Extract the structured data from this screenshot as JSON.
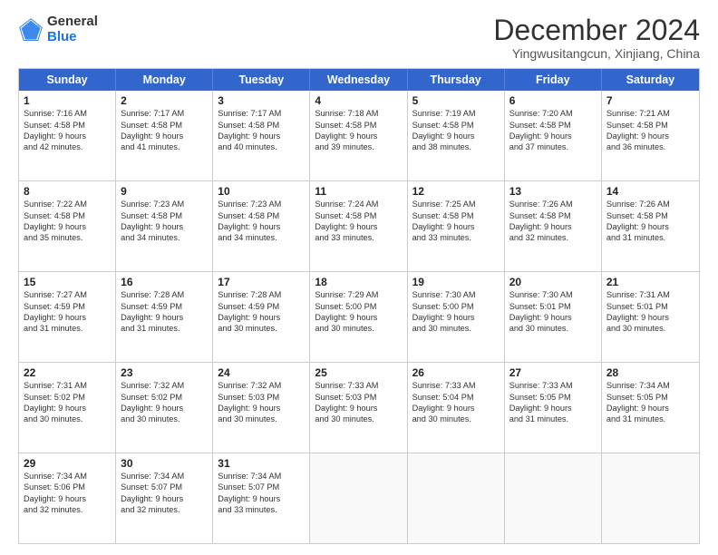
{
  "logo": {
    "general": "General",
    "blue": "Blue"
  },
  "title": "December 2024",
  "subtitle": "Yingwusitangcun, Xinjiang, China",
  "weekdays": [
    "Sunday",
    "Monday",
    "Tuesday",
    "Wednesday",
    "Thursday",
    "Friday",
    "Saturday"
  ],
  "rows": [
    [
      {
        "day": "1",
        "lines": [
          "Sunrise: 7:16 AM",
          "Sunset: 4:58 PM",
          "Daylight: 9 hours",
          "and 42 minutes."
        ]
      },
      {
        "day": "2",
        "lines": [
          "Sunrise: 7:17 AM",
          "Sunset: 4:58 PM",
          "Daylight: 9 hours",
          "and 41 minutes."
        ]
      },
      {
        "day": "3",
        "lines": [
          "Sunrise: 7:17 AM",
          "Sunset: 4:58 PM",
          "Daylight: 9 hours",
          "and 40 minutes."
        ]
      },
      {
        "day": "4",
        "lines": [
          "Sunrise: 7:18 AM",
          "Sunset: 4:58 PM",
          "Daylight: 9 hours",
          "and 39 minutes."
        ]
      },
      {
        "day": "5",
        "lines": [
          "Sunrise: 7:19 AM",
          "Sunset: 4:58 PM",
          "Daylight: 9 hours",
          "and 38 minutes."
        ]
      },
      {
        "day": "6",
        "lines": [
          "Sunrise: 7:20 AM",
          "Sunset: 4:58 PM",
          "Daylight: 9 hours",
          "and 37 minutes."
        ]
      },
      {
        "day": "7",
        "lines": [
          "Sunrise: 7:21 AM",
          "Sunset: 4:58 PM",
          "Daylight: 9 hours",
          "and 36 minutes."
        ]
      }
    ],
    [
      {
        "day": "8",
        "lines": [
          "Sunrise: 7:22 AM",
          "Sunset: 4:58 PM",
          "Daylight: 9 hours",
          "and 35 minutes."
        ]
      },
      {
        "day": "9",
        "lines": [
          "Sunrise: 7:23 AM",
          "Sunset: 4:58 PM",
          "Daylight: 9 hours",
          "and 34 minutes."
        ]
      },
      {
        "day": "10",
        "lines": [
          "Sunrise: 7:23 AM",
          "Sunset: 4:58 PM",
          "Daylight: 9 hours",
          "and 34 minutes."
        ]
      },
      {
        "day": "11",
        "lines": [
          "Sunrise: 7:24 AM",
          "Sunset: 4:58 PM",
          "Daylight: 9 hours",
          "and 33 minutes."
        ]
      },
      {
        "day": "12",
        "lines": [
          "Sunrise: 7:25 AM",
          "Sunset: 4:58 PM",
          "Daylight: 9 hours",
          "and 33 minutes."
        ]
      },
      {
        "day": "13",
        "lines": [
          "Sunrise: 7:26 AM",
          "Sunset: 4:58 PM",
          "Daylight: 9 hours",
          "and 32 minutes."
        ]
      },
      {
        "day": "14",
        "lines": [
          "Sunrise: 7:26 AM",
          "Sunset: 4:58 PM",
          "Daylight: 9 hours",
          "and 31 minutes."
        ]
      }
    ],
    [
      {
        "day": "15",
        "lines": [
          "Sunrise: 7:27 AM",
          "Sunset: 4:59 PM",
          "Daylight: 9 hours",
          "and 31 minutes."
        ]
      },
      {
        "day": "16",
        "lines": [
          "Sunrise: 7:28 AM",
          "Sunset: 4:59 PM",
          "Daylight: 9 hours",
          "and 31 minutes."
        ]
      },
      {
        "day": "17",
        "lines": [
          "Sunrise: 7:28 AM",
          "Sunset: 4:59 PM",
          "Daylight: 9 hours",
          "and 30 minutes."
        ]
      },
      {
        "day": "18",
        "lines": [
          "Sunrise: 7:29 AM",
          "Sunset: 5:00 PM",
          "Daylight: 9 hours",
          "and 30 minutes."
        ]
      },
      {
        "day": "19",
        "lines": [
          "Sunrise: 7:30 AM",
          "Sunset: 5:00 PM",
          "Daylight: 9 hours",
          "and 30 minutes."
        ]
      },
      {
        "day": "20",
        "lines": [
          "Sunrise: 7:30 AM",
          "Sunset: 5:01 PM",
          "Daylight: 9 hours",
          "and 30 minutes."
        ]
      },
      {
        "day": "21",
        "lines": [
          "Sunrise: 7:31 AM",
          "Sunset: 5:01 PM",
          "Daylight: 9 hours",
          "and 30 minutes."
        ]
      }
    ],
    [
      {
        "day": "22",
        "lines": [
          "Sunrise: 7:31 AM",
          "Sunset: 5:02 PM",
          "Daylight: 9 hours",
          "and 30 minutes."
        ]
      },
      {
        "day": "23",
        "lines": [
          "Sunrise: 7:32 AM",
          "Sunset: 5:02 PM",
          "Daylight: 9 hours",
          "and 30 minutes."
        ]
      },
      {
        "day": "24",
        "lines": [
          "Sunrise: 7:32 AM",
          "Sunset: 5:03 PM",
          "Daylight: 9 hours",
          "and 30 minutes."
        ]
      },
      {
        "day": "25",
        "lines": [
          "Sunrise: 7:33 AM",
          "Sunset: 5:03 PM",
          "Daylight: 9 hours",
          "and 30 minutes."
        ]
      },
      {
        "day": "26",
        "lines": [
          "Sunrise: 7:33 AM",
          "Sunset: 5:04 PM",
          "Daylight: 9 hours",
          "and 30 minutes."
        ]
      },
      {
        "day": "27",
        "lines": [
          "Sunrise: 7:33 AM",
          "Sunset: 5:05 PM",
          "Daylight: 9 hours",
          "and 31 minutes."
        ]
      },
      {
        "day": "28",
        "lines": [
          "Sunrise: 7:34 AM",
          "Sunset: 5:05 PM",
          "Daylight: 9 hours",
          "and 31 minutes."
        ]
      }
    ],
    [
      {
        "day": "29",
        "lines": [
          "Sunrise: 7:34 AM",
          "Sunset: 5:06 PM",
          "Daylight: 9 hours",
          "and 32 minutes."
        ]
      },
      {
        "day": "30",
        "lines": [
          "Sunrise: 7:34 AM",
          "Sunset: 5:07 PM",
          "Daylight: 9 hours",
          "and 32 minutes."
        ]
      },
      {
        "day": "31",
        "lines": [
          "Sunrise: 7:34 AM",
          "Sunset: 5:07 PM",
          "Daylight: 9 hours",
          "and 33 minutes."
        ]
      },
      null,
      null,
      null,
      null
    ]
  ]
}
